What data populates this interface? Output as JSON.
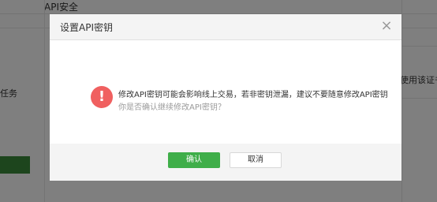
{
  "background": {
    "page_title": "API安全",
    "left_fragment": "任务",
    "right_fragment": "使用该证书"
  },
  "dialog": {
    "title": "设置API密钥",
    "message": "修改API密钥可能会影响线上交易，若非密钥泄漏，建议不要随意修改API密钥",
    "sub_message": "你是否确认继续修改API密钥？",
    "confirm_label": "确认",
    "cancel_label": "取消",
    "close_symbol": "×",
    "warning_symbol": "!"
  },
  "colors": {
    "confirm": "#3fae49",
    "warning": "#f06060"
  }
}
